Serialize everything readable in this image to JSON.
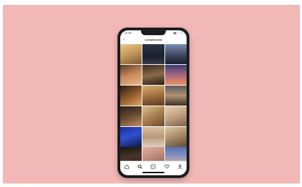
{
  "status_bar": {
    "time": "12:30",
    "icons": "▮▮ ◠ ▭"
  },
  "profile": {
    "username": "ev.fowlerecent"
  },
  "colors": {
    "background": "#f2b8b5",
    "phone_frame": "#1c1c1e",
    "screen": "#ffffff"
  },
  "photos": [
    {
      "name": "photo-blonde-sunset",
      "bg": "linear-gradient(160deg,#e8c98d 0%,#c89a5b 45%,#7a5a3a 100%)"
    },
    {
      "name": "photo-night-sky",
      "bg": "linear-gradient(180deg,#2c3548 0%,#1a2030 60%,#3a3a4a 100%)"
    },
    {
      "name": "photo-palm-dusk",
      "bg": "linear-gradient(180deg,#7c8fb0 0%,#3e4660 55%,#1d2030 100%)"
    },
    {
      "name": "photo-selfie-warm",
      "bg": "linear-gradient(160deg,#5a3a2a 0%,#c9895a 50%,#e8b888 100%)"
    },
    {
      "name": "photo-street-night",
      "bg": "linear-gradient(170deg,#3a2a22 0%,#8a6a4a 50%,#2a1e18 100%)"
    },
    {
      "name": "photo-sunset-sky",
      "bg": "linear-gradient(180deg,#3c3f70 0%,#b06a80 55%,#e8905a 100%)"
    },
    {
      "name": "photo-portrait-lamp",
      "bg": "linear-gradient(150deg,#2a1a10 0%,#9a6030 55%,#e0a860 100%)"
    },
    {
      "name": "photo-mirror-gold",
      "bg": "linear-gradient(170deg,#d8b070 0%,#a07040 50%,#5a3a20 100%)"
    },
    {
      "name": "photo-beach-dusk",
      "bg": "linear-gradient(180deg,#5a5a60 0%,#b09070 50%,#3a3028 100%)"
    },
    {
      "name": "photo-girl-window",
      "bg": "linear-gradient(160deg,#2a2018 0%,#6a4a30 50%,#c09060 100%)"
    },
    {
      "name": "photo-blonde-hair",
      "bg": "linear-gradient(150deg,#d8c090 0%,#a88050 50%,#6a4a30 100%)"
    },
    {
      "name": "photo-closeup-face",
      "bg": "linear-gradient(160deg,#e8d0b0 0%,#c0a080 50%,#806048 100%)"
    },
    {
      "name": "photo-blue-lights",
      "bg": "linear-gradient(160deg,#1a2aa0 0%,#3050d0 45%,#101840 100%)"
    },
    {
      "name": "photo-gallery-frames",
      "bg": "linear-gradient(180deg,#d8c0a8 0%,#b89878 50%,#e0d0c0 100%)"
    },
    {
      "name": "photo-friends-group",
      "bg": "linear-gradient(160deg,#e0c8a8 0%,#a88868 50%,#604838 100%)"
    },
    {
      "name": "photo-night-car",
      "bg": "linear-gradient(170deg,#1a1410 0%,#4a3628 50%,#2a1e18 100%)"
    },
    {
      "name": "photo-pink-light",
      "bg": "linear-gradient(160deg,#e0b0a8 0%,#c08878 50%,#806058 100%)"
    },
    {
      "name": "photo-horizon-blue",
      "bg": "linear-gradient(180deg,#5070b0 0%,#9098c0 50%,#e8b880 100%)"
    }
  ],
  "tabs": [
    {
      "name": "tab-home",
      "icon": "home-icon"
    },
    {
      "name": "tab-search",
      "icon": "search-icon"
    },
    {
      "name": "tab-reels",
      "icon": "reels-icon"
    },
    {
      "name": "tab-activity",
      "icon": "heart-icon"
    },
    {
      "name": "tab-profile",
      "icon": "profile-icon"
    }
  ]
}
